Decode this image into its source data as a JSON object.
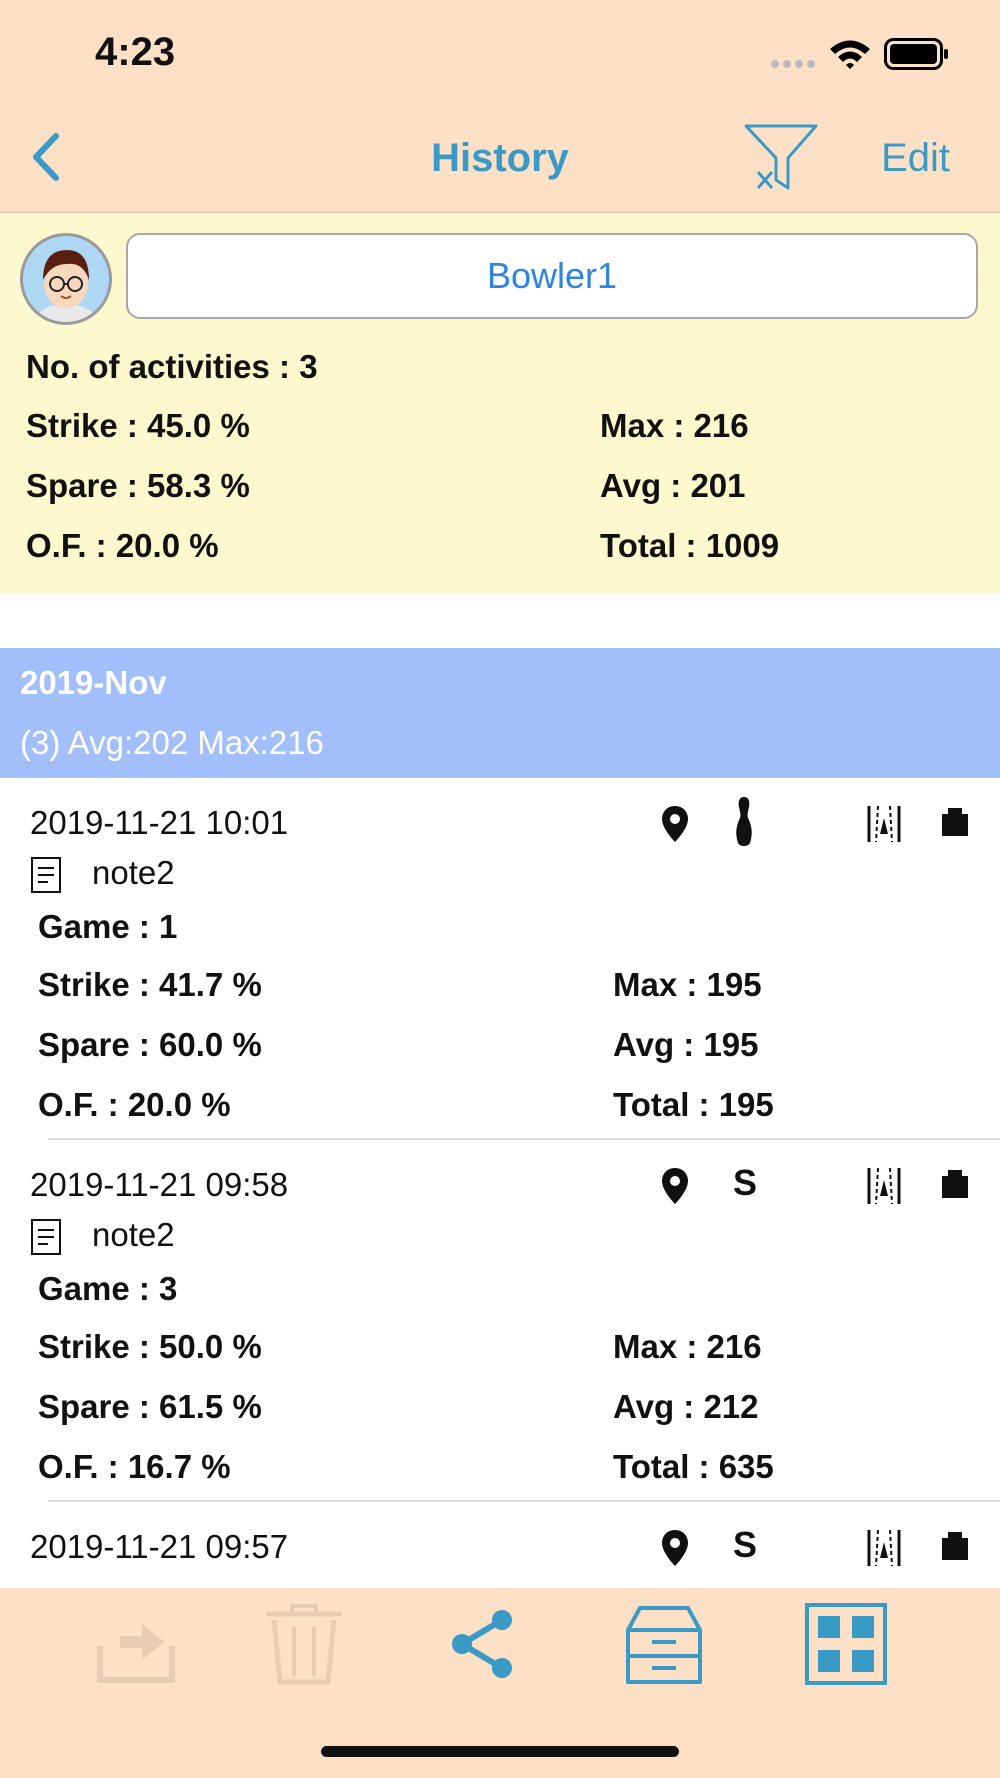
{
  "status": {
    "time": "4:23"
  },
  "nav": {
    "title": "History",
    "edit_label": "Edit"
  },
  "profile": {
    "name": "Bowler1"
  },
  "summary": {
    "activities": "No. of activities : 3",
    "strike": "Strike : 45.0 %",
    "spare": "Spare : 58.3 %",
    "of": "O.F. : 20.0 %",
    "max": "Max : 216",
    "avg": "Avg : 201",
    "total": "Total : 1009"
  },
  "section": {
    "title": "2019-Nov",
    "subtitle": "(3)  Avg:202  Max:216"
  },
  "entries": [
    {
      "date": "2019-11-21 10:01",
      "note": "note2",
      "game": "Game : 1",
      "strike": "Strike : 41.7 %",
      "spare": "Spare : 60.0 %",
      "of": "O.F. : 20.0 %",
      "max": "Max : 195",
      "avg": "Avg : 195",
      "total": "Total : 195",
      "type_icon": "bowling-pin-icon"
    },
    {
      "date": "2019-11-21 09:58",
      "note": "note2",
      "game": "Game : 3",
      "strike": "Strike : 50.0 %",
      "spare": "Spare : 61.5 %",
      "of": "O.F. : 16.7 %",
      "max": "Max : 216",
      "avg": "Avg : 212",
      "total": "Total : 635",
      "type_label": "S"
    },
    {
      "date": "2019-11-21 09:57",
      "type_label": "S"
    }
  ],
  "toolbar_icons": [
    "export-icon",
    "trash-icon",
    "share-icon",
    "archive-icon",
    "grid-icon"
  ],
  "colors": {
    "accent": "#3a9ac6",
    "header_bg": "#fde0c5",
    "summary_bg": "#fdf8cd",
    "section_bg": "#a3bffb",
    "name_text": "#2c86e0"
  }
}
